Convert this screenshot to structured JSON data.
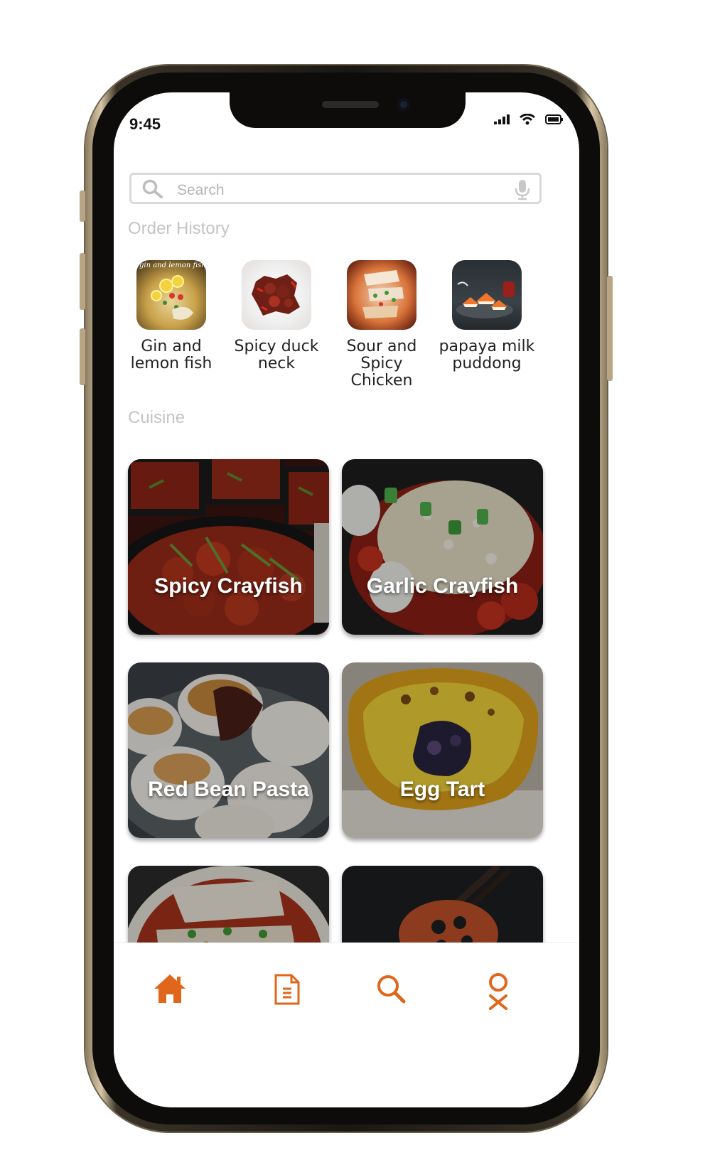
{
  "status_bar": {
    "time": "9:45"
  },
  "search": {
    "placeholder": "Search"
  },
  "sections": {
    "order_history": "Order History",
    "cuisine": "Cuisine"
  },
  "order_history": [
    {
      "name": "Gin and lemon fish",
      "line1": "Gin and",
      "line2": "lemon fish",
      "thumb_caption": "gin and lemon fish"
    },
    {
      "name": "Spicy duck neck",
      "line1": "Spicy duck",
      "line2": "neck"
    },
    {
      "name": "Sour and Spicy Chicken",
      "line1": "Sour and",
      "line2": "Spicy Chicken"
    },
    {
      "name": "papaya milk puddong",
      "line1": "papaya milk",
      "line2": "puddong"
    }
  ],
  "cuisine": [
    {
      "label": "Spicy Crayfish"
    },
    {
      "label": "Garlic Crayfish"
    },
    {
      "label": "Red Bean Pasta"
    },
    {
      "label": "Egg Tart"
    },
    {
      "label": ""
    },
    {
      "label": ""
    }
  ],
  "tab_bar": {
    "items": [
      {
        "icon": "home-icon"
      },
      {
        "icon": "document-icon"
      },
      {
        "icon": "search-icon"
      },
      {
        "icon": "profile-icon"
      }
    ]
  },
  "colors": {
    "accent": "#e0661c",
    "muted_text": "#c4c4c4"
  }
}
